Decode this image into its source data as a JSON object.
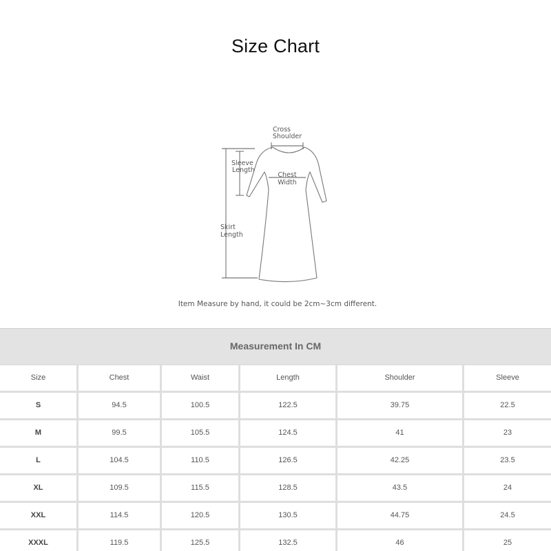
{
  "title": "Size Chart",
  "diagram": {
    "cross_shoulder": [
      "Cross",
      "Shoulder"
    ],
    "sleeve_length": [
      "Sleeve",
      "Length"
    ],
    "chest_width": [
      "Chest",
      "Width"
    ],
    "skirt_length": [
      "Skirt",
      "Length"
    ]
  },
  "note": "Item Measure by hand, it could be 2cm~3cm different.",
  "table": {
    "caption": "Measurement In CM",
    "headers": [
      "Size",
      "Chest",
      "Waist",
      "Length",
      "Shoulder",
      "Sleeve"
    ],
    "rows": [
      [
        "S",
        "94.5",
        "100.5",
        "122.5",
        "39.75",
        "22.5"
      ],
      [
        "M",
        "99.5",
        "105.5",
        "124.5",
        "41",
        "23"
      ],
      [
        "L",
        "104.5",
        "110.5",
        "126.5",
        "42.25",
        "23.5"
      ],
      [
        "XL",
        "109.5",
        "115.5",
        "128.5",
        "43.5",
        "24"
      ],
      [
        "XXL",
        "114.5",
        "120.5",
        "130.5",
        "44.75",
        "24.5"
      ],
      [
        "XXXL",
        "119.5",
        "125.5",
        "132.5",
        "46",
        "25"
      ]
    ]
  }
}
